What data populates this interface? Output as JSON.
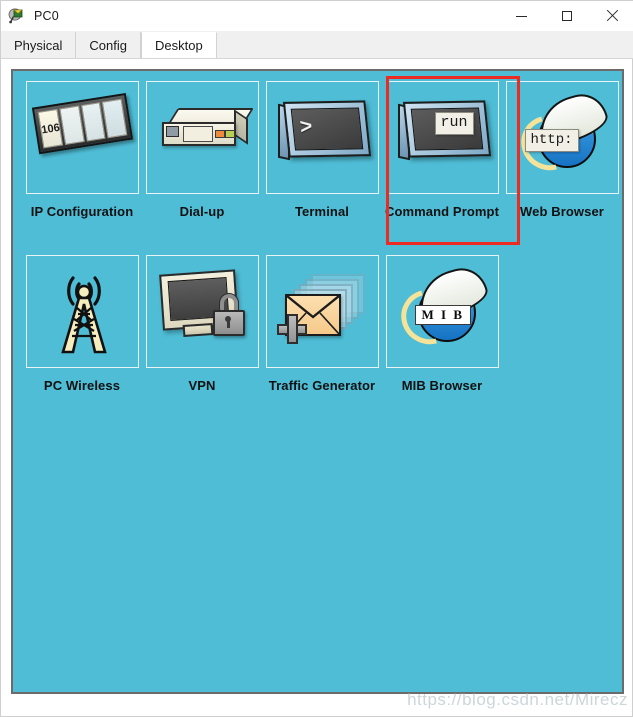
{
  "window": {
    "title": "PC0",
    "app_icon": "packet-tracer-icon",
    "controls": {
      "minimize": "minimize-icon",
      "maximize": "maximize-icon",
      "close": "close-icon"
    }
  },
  "tabs": [
    {
      "label": "Physical",
      "active": false
    },
    {
      "label": "Config",
      "active": false
    },
    {
      "label": "Desktop",
      "active": true
    }
  ],
  "desktop": {
    "background_color": "#4fbdd6",
    "highlight_color": "#ee2b22",
    "highlighted_item": "Command Prompt",
    "items": [
      {
        "label": "IP Configuration",
        "icon": "ip-configuration-icon",
        "badge": "106"
      },
      {
        "label": "Dial-up",
        "icon": "dial-up-modem-icon"
      },
      {
        "label": "Terminal",
        "icon": "terminal-monitor-icon",
        "screen_text": ">"
      },
      {
        "label": "Command Prompt",
        "icon": "command-prompt-icon",
        "tooltip": "run"
      },
      {
        "label": "Web Browser",
        "icon": "web-browser-globe-icon",
        "tooltip": "http:"
      },
      {
        "label": "PC Wireless",
        "icon": "wireless-tower-icon"
      },
      {
        "label": "VPN",
        "icon": "vpn-lock-icon"
      },
      {
        "label": "Traffic Generator",
        "icon": "traffic-generator-icon"
      },
      {
        "label": "MIB Browser",
        "icon": "mib-browser-globe-icon",
        "badge": "M I B"
      }
    ]
  },
  "watermark": {
    "text": "https://blog.csdn.net/Mirecz"
  }
}
